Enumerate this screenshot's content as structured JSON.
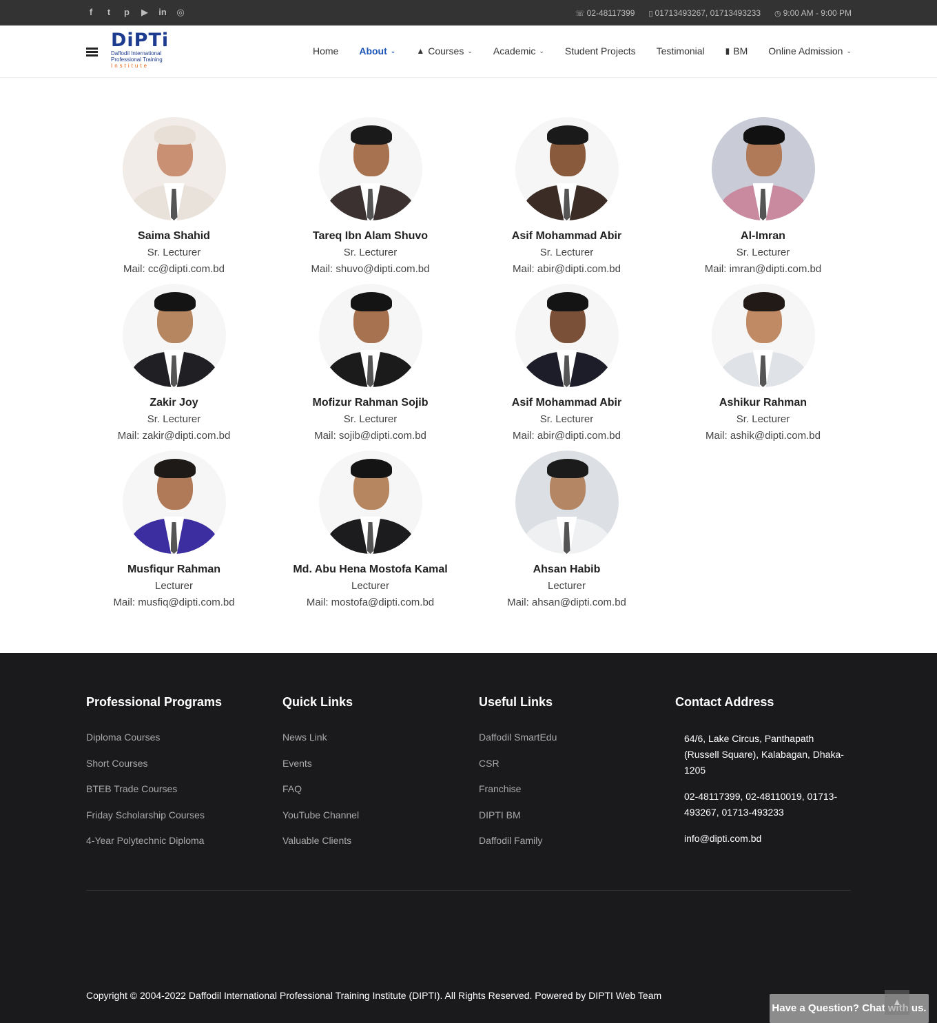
{
  "topbar": {
    "social_icons": [
      "facebook-icon",
      "twitter-icon",
      "pinterest-icon",
      "youtube-icon",
      "linkedin-icon",
      "instagram-icon"
    ],
    "phone": "02-48117399",
    "mobile": "01713493267, 01713493233",
    "hours": "9:00 AM - 9:00 PM"
  },
  "header": {
    "logo": {
      "brand": "DiPTi",
      "line1": "Daffodil International",
      "line2": "Professional Training",
      "line3": "Institute"
    },
    "nav": [
      {
        "label": "Home",
        "has_dropdown": false
      },
      {
        "label": "About",
        "has_dropdown": true,
        "active": true
      },
      {
        "label": "Courses",
        "has_dropdown": true,
        "icon": "graduation-cap-icon"
      },
      {
        "label": "Academic",
        "has_dropdown": true
      },
      {
        "label": "Student Projects",
        "has_dropdown": false
      },
      {
        "label": "Testimonial",
        "has_dropdown": false
      },
      {
        "label": "BM",
        "has_dropdown": false,
        "icon": "book-icon"
      },
      {
        "label": "Online Admission",
        "has_dropdown": true
      }
    ],
    "accent_color": "#1e56b8"
  },
  "faculty": [
    {
      "name": "Saima Shahid",
      "role": "Sr. Lecturer",
      "mail": "Mail: cc@dipti.com.bd"
    },
    {
      "name": "Tareq Ibn Alam Shuvo",
      "role": "Sr. Lecturer",
      "mail": "Mail: shuvo@dipti.com.bd"
    },
    {
      "name": "Asif Mohammad Abir",
      "role": "Sr. Lecturer",
      "mail": "Mail: abir@dipti.com.bd"
    },
    {
      "name": "Al-Imran",
      "role": "Sr. Lecturer",
      "mail": "Mail: imran@dipti.com.bd"
    },
    {
      "name": "Zakir Joy",
      "role": "Sr. Lecturer",
      "mail": "Mail: zakir@dipti.com.bd"
    },
    {
      "name": "Mofizur Rahman Sojib",
      "role": "Sr. Lecturer",
      "mail": "Mail: sojib@dipti.com.bd"
    },
    {
      "name": "Asif Mohammad Abir",
      "role": "Sr. Lecturer",
      "mail": "Mail: abir@dipti.com.bd"
    },
    {
      "name": "Ashikur Rahman",
      "role": "Sr. Lecturer",
      "mail": "Mail: ashik@dipti.com.bd"
    },
    {
      "name": "Musfiqur Rahman",
      "role": "Lecturer",
      "mail": "Mail: musfiq@dipti.com.bd"
    },
    {
      "name": "Md. Abu Hena Mostofa Kamal",
      "role": "Lecturer",
      "mail": "Mail: mostofa@dipti.com.bd"
    },
    {
      "name": "Ahsan Habib",
      "role": "Lecturer",
      "mail": "Mail: ahsan@dipti.com.bd"
    }
  ],
  "footer": {
    "programs": {
      "title": "Professional Programs",
      "links": [
        "Diploma Courses",
        "Short Courses",
        "BTEB Trade Courses",
        "Friday Scholarship Courses",
        "4-Year Polytechnic Diploma"
      ]
    },
    "quick": {
      "title": "Quick Links",
      "links": [
        "News Link",
        "Events",
        "FAQ",
        "YouTube Channel",
        "Valuable Clients"
      ]
    },
    "useful": {
      "title": "Useful Links",
      "links": [
        "Daffodil SmartEdu",
        "CSR",
        "Franchise",
        "DIPTI BM",
        "Daffodil Family"
      ]
    },
    "contact": {
      "title": "Contact Address",
      "address": "64/6, Lake Circus, Panthapath (Russell Square), Kalabagan, Dhaka-1205",
      "phones": "02-48117399, 02-48110019, 01713-493267, 01713-493233",
      "email": "info@dipti.com.bd"
    },
    "copyright": "Copyright © 2004-2022 Daffodil International Professional Training Institute (DIPTI). All Rights Reserved. Powered by DIPTI Web Team"
  },
  "chat_widget": {
    "label": "Have a Question? Chat with us."
  },
  "back_to_top_icon": "chevron-up-icon"
}
